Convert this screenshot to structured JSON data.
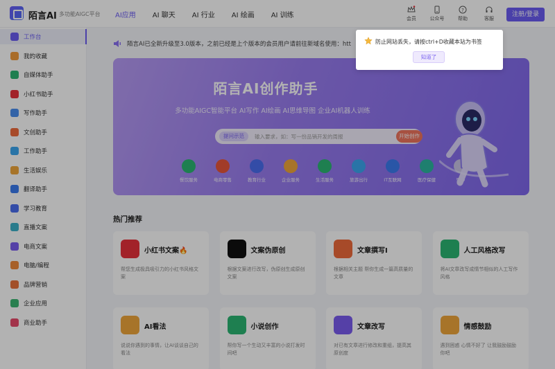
{
  "header": {
    "brand": "陌言AI",
    "slogan": "多功能AIGC平台",
    "nav": [
      "AI应用",
      "AI 聊天",
      "AI 行业",
      "AI 绘画",
      "AI 训练"
    ],
    "icons": [
      {
        "label": "会员",
        "icon": "crown-icon"
      },
      {
        "label": "公众号",
        "icon": "phone-icon"
      },
      {
        "label": "帮助",
        "icon": "help-icon"
      },
      {
        "label": "客服",
        "icon": "headset-icon"
      }
    ],
    "login": "注册/登录"
  },
  "sidebar": {
    "items": [
      {
        "label": "工作台",
        "color": "#6a5cf2"
      },
      {
        "label": "我的收藏",
        "color": "#f39b3b"
      },
      {
        "label": "自媒体助手",
        "color": "#2bb673"
      },
      {
        "label": "小红书助手",
        "color": "#e8323c"
      },
      {
        "label": "写作助手",
        "color": "#4a8ef0"
      },
      {
        "label": "文创助手",
        "color": "#f06a3b"
      },
      {
        "label": "工作助手",
        "color": "#3ba6f0"
      },
      {
        "label": "生活娱乐",
        "color": "#f0a63b"
      },
      {
        "label": "翻译助手",
        "color": "#3b7bf0"
      },
      {
        "label": "学习教育",
        "color": "#4a6ef0"
      },
      {
        "label": "直播文案",
        "color": "#3bb0c9"
      },
      {
        "label": "电商文案",
        "color": "#7a5cf0"
      },
      {
        "label": "电脑/编程",
        "color": "#f08a3b"
      },
      {
        "label": "品牌营销",
        "color": "#e8723c"
      },
      {
        "label": "企业应用",
        "color": "#3bb673"
      },
      {
        "label": "商业助手",
        "color": "#e84a6a"
      }
    ]
  },
  "notice": {
    "text": "陌言AI已全新升级至3.0版本，之前已经是上个版本的会员用户请前往新域名使用：htt"
  },
  "hero": {
    "title": "陌言AI创作助手",
    "subtitle": "多功能AIGC智能平台 AI写作 AI绘画 AI思维导图 企业AI机器人训练",
    "search_tag": "提问示范",
    "search_placeholder": "输入要求，如：写一份品销开发的周报",
    "search_button": "开始创作",
    "categories": [
      {
        "label": "餐饮服务",
        "color": "#2bb673"
      },
      {
        "label": "电商零售",
        "color": "#e8573c"
      },
      {
        "label": "教育行业",
        "color": "#4a6ef0"
      },
      {
        "label": "企业服务",
        "color": "#f0a63b"
      },
      {
        "label": "生活服务",
        "color": "#2bb673"
      },
      {
        "label": "旅游出行",
        "color": "#3ba6f0"
      },
      {
        "label": "IT互联网",
        "color": "#3b7bf0"
      },
      {
        "label": "医疗保健",
        "color": "#2bb6a0"
      },
      {
        "label": "更多",
        "color": "#c9c3e6"
      }
    ]
  },
  "section": {
    "title": "热门推荐"
  },
  "cards": [
    {
      "title": "小红书文案🔥",
      "desc": "帮您生成极具吸引力的小红书风格文案",
      "color": "#e8323c"
    },
    {
      "title": "文案伪原创",
      "desc": "根据文案进行改写，伪原创生成原创文案",
      "color": "#111111"
    },
    {
      "title": "文章撰写I",
      "desc": "根据相关主题 帮你生成一篇高质量的文章",
      "color": "#f06a3b"
    },
    {
      "title": "人工风格改写",
      "desc": "将AI文章改写成情节相似的人工写作风格",
      "color": "#2bb673"
    },
    {
      "title": "AI看法",
      "desc": "说说你遇到的事情，让AI谈谈自己的看法",
      "color": "#f0a63b"
    },
    {
      "title": "小说创作",
      "desc": "帮你写一个生动又丰富的小说打发时间吧",
      "color": "#2bb673"
    },
    {
      "title": "文章改写",
      "desc": "对已有文章进行修改和重组，提高其原创度",
      "color": "#7a5cf0"
    },
    {
      "title": "情感鼓励",
      "desc": "遇到困惑 心情不好了 让我鼓励鼓励你吧",
      "color": "#f0a63b"
    }
  ],
  "popup": {
    "text": "防止网站丢失，请按ctrl+D收藏本站为书签",
    "button": "知道了"
  }
}
